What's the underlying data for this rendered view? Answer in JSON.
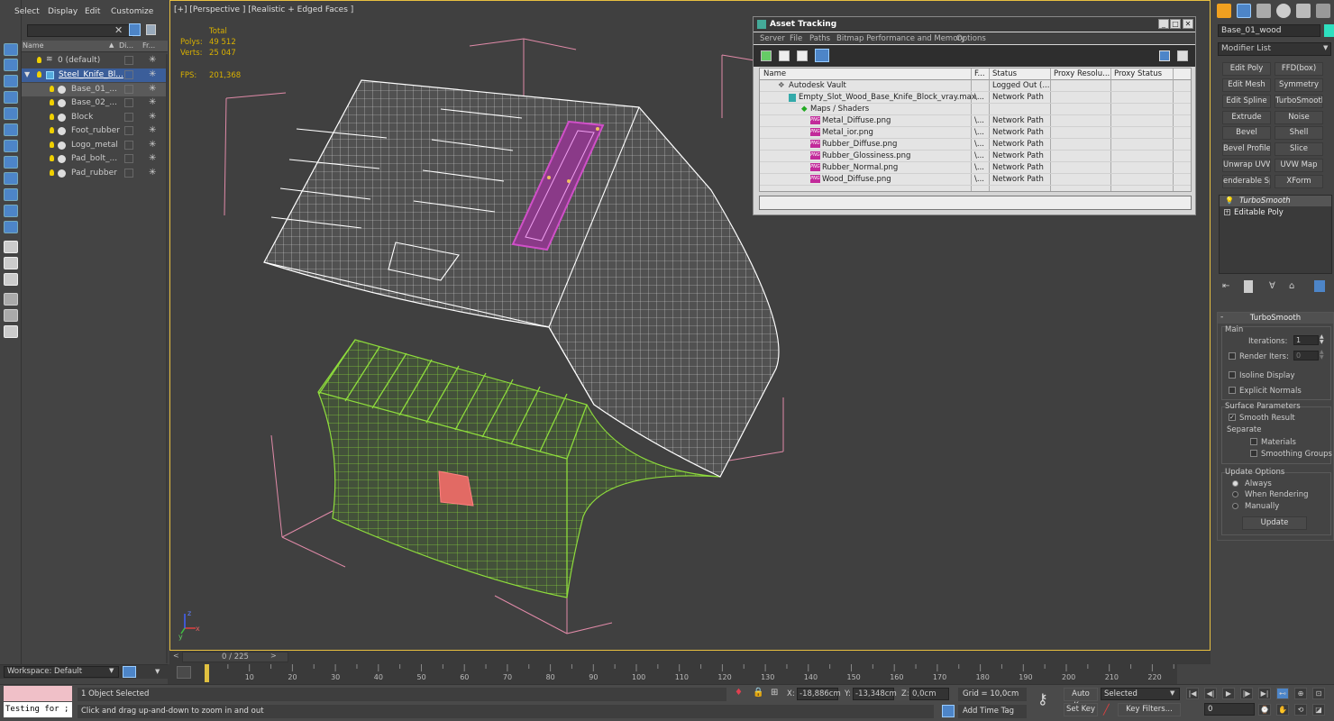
{
  "explorer": {
    "menu": [
      "Select",
      "Display",
      "Edit",
      "Customize"
    ],
    "columns": {
      "name": "Name",
      "display": "Di...",
      "freeze": "Fr..."
    },
    "rows": [
      {
        "label": "0 (default)"
      },
      {
        "label": "Steel_Knife_Bl..."
      },
      {
        "label": "Base_01_..."
      },
      {
        "label": "Base_02_..."
      },
      {
        "label": "Block"
      },
      {
        "label": "Foot_rubber"
      },
      {
        "label": "Logo_metal"
      },
      {
        "label": "Pad_bolt_..."
      },
      {
        "label": "Pad_rubber"
      }
    ],
    "workspace": "Workspace: Default"
  },
  "viewport": {
    "label": "[+] [Perspective ] [Realistic + Edged Faces ]",
    "stats": {
      "total_label": "Total",
      "polys_label": "Polys:",
      "polys_value": "49 512",
      "verts_label": "Verts:",
      "verts_value": "25 047",
      "fps_label": "FPS:",
      "fps_value": "201,368"
    },
    "colors": {
      "selection_frame": "#e8c040",
      "knife_block": "#ffffff",
      "base": "#8edc3c",
      "pad": "#d050c8",
      "logo": "#e26a64"
    }
  },
  "asset_tracking": {
    "title": "Asset Tracking",
    "menu": [
      "Server",
      "File",
      "Paths",
      "Bitmap Performance and Memory",
      "Options"
    ],
    "columns": [
      "Name",
      "F...",
      "Status",
      "Proxy Resolu...",
      "Proxy Status"
    ],
    "rows": [
      {
        "name": "Autodesk Vault",
        "f": "",
        "status": "Logged Out (..."
      },
      {
        "name": "Empty_Slot_Wood_Base_Knife_Block_vray.max",
        "f": "\\...",
        "status": "Network Path"
      },
      {
        "name": "Maps / Shaders",
        "f": "",
        "status": ""
      },
      {
        "name": "Metal_Diffuse.png",
        "f": "\\...",
        "status": "Network Path"
      },
      {
        "name": "Metal_ior.png",
        "f": "\\...",
        "status": "Network Path"
      },
      {
        "name": "Rubber_Diffuse.png",
        "f": "\\...",
        "status": "Network Path"
      },
      {
        "name": "Rubber_Glossiness.png",
        "f": "\\...",
        "status": "Network Path"
      },
      {
        "name": "Rubber_Normal.png",
        "f": "\\...",
        "status": "Network Path"
      },
      {
        "name": "Wood_Diffuse.png",
        "f": "\\...",
        "status": "Network Path"
      }
    ],
    "png_tag": "PNG"
  },
  "command_panel": {
    "object_name": "Base_01_wood",
    "modifier_list": "Modifier List",
    "buttons": [
      "Edit Poly",
      "FFD(box)",
      "Edit Mesh",
      "Symmetry",
      "Edit Spline",
      "TurboSmooth",
      "Extrude",
      "Noise",
      "Bevel",
      "Shell",
      "Bevel Profile",
      "Slice",
      "Unwrap UVW",
      "UVW Map",
      "enderable Splin",
      "XForm"
    ],
    "stack": [
      "TurboSmooth",
      "Editable Poly"
    ],
    "rollout": {
      "title": "TurboSmooth",
      "main": "Main",
      "iterations_label": "Iterations:",
      "iterations_value": "1",
      "render_iters_label": "Render Iters:",
      "render_iters_value": "0",
      "isoline": "Isoline Display",
      "explicit_normals": "Explicit Normals",
      "surface_params": "Surface Parameters",
      "smooth_result": "Smooth Result",
      "separate": "Separate",
      "materials": "Materials",
      "smoothing_groups": "Smoothing Groups",
      "update_options": "Update Options",
      "always": "Always",
      "when_rendering": "When Rendering",
      "manually": "Manually",
      "update_button": "Update"
    }
  },
  "timeline": {
    "slider": "0 / 225",
    "ticks": [
      "0",
      "10",
      "20",
      "30",
      "40",
      "50",
      "60",
      "70",
      "80",
      "90",
      "100",
      "110",
      "120",
      "130",
      "140",
      "150",
      "160",
      "170",
      "180",
      "190",
      "200",
      "210",
      "220"
    ]
  },
  "statusbar": {
    "maxscript": "Testing for ;",
    "selection": "1 Object Selected",
    "prompt": "Click and drag up-and-down to zoom in and out",
    "x_label": "X:",
    "x_value": "-18,886cm",
    "y_label": "Y:",
    "y_value": "-13,348cm",
    "z_label": "Z:",
    "z_value": "0,0cm",
    "grid": "Grid = 10,0cm",
    "add_time_tag": "Add Time Tag",
    "auto_key": "Auto Key",
    "set_key": "Set Key",
    "selected": "Selected",
    "key_filters": "Key Filters...",
    "frame": "0"
  }
}
